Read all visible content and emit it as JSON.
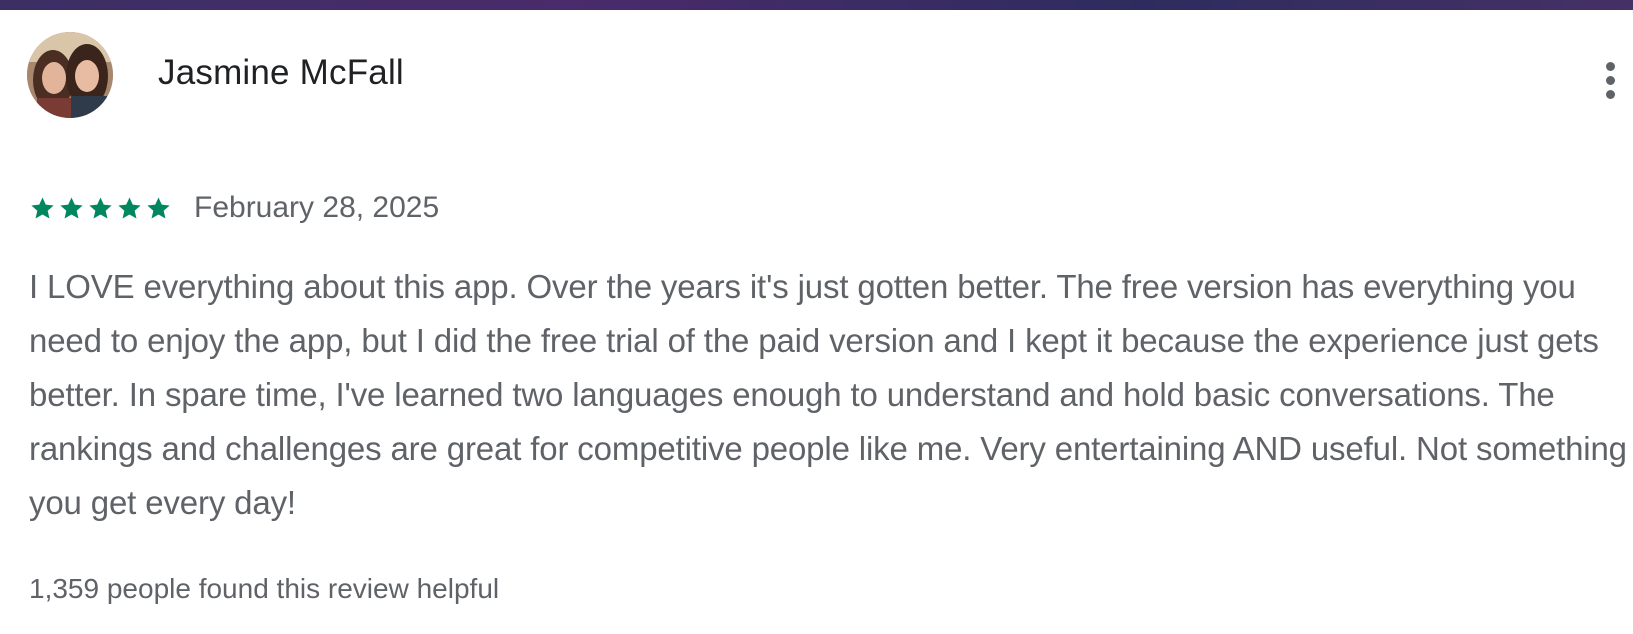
{
  "review": {
    "reviewer_name": "Jasmine McFall",
    "rating": 5,
    "rating_max": 5,
    "star_color": "#01875f",
    "date": "February 28, 2025",
    "text": "I LOVE everything about this app. Over the years it's just gotten better. The free version has everything you need to enjoy the app, but I did the free trial of the paid version and I kept it because the experience just gets better. In spare time, I've learned two languages enough to understand and hold basic conversations. The rankings and challenges are great for competitive people like me. Very entertaining AND useful. Not something you get every day!",
    "helpful_text": "1,359 people found this review helpful",
    "avatar_icon": "user-photo",
    "menu_icon": "more-vert-icon"
  }
}
